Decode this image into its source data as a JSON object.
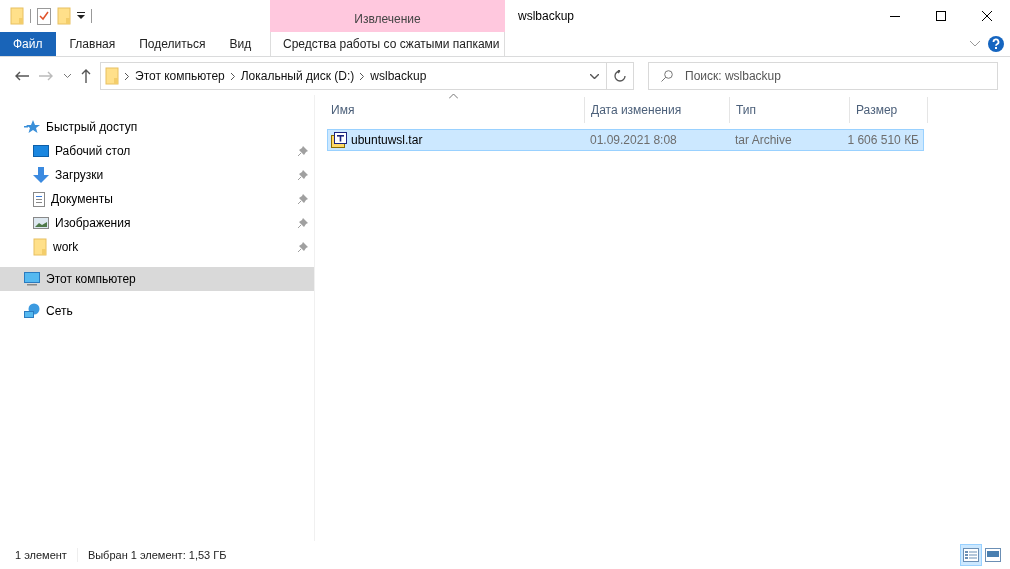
{
  "window": {
    "title": "wslbackup"
  },
  "contextual_group": {
    "label": "Извлечение"
  },
  "ribbon_tabs": [
    {
      "label": "Файл",
      "kind": "file"
    },
    {
      "label": "Главная",
      "kind": "normal"
    },
    {
      "label": "Поделиться",
      "kind": "normal"
    },
    {
      "label": "Вид",
      "kind": "normal"
    },
    {
      "label": "Средства работы со сжатыми папками",
      "kind": "contextual"
    }
  ],
  "address": {
    "path": [
      "Этот компьютер",
      "Локальный диск (D:)",
      "wslbackup"
    ]
  },
  "search": {
    "placeholder": "Поиск: wslbackup"
  },
  "sidebar": {
    "items": [
      {
        "label": "Быстрый доступ",
        "kind": "star",
        "selected": false,
        "children": [
          {
            "label": "Рабочий стол",
            "kind": "desktop",
            "pinned": true,
            "selected": false
          },
          {
            "label": "Загрузки",
            "kind": "download",
            "pinned": true,
            "selected": false
          },
          {
            "label": "Документы",
            "kind": "document",
            "pinned": true,
            "selected": false
          },
          {
            "label": "Изображения",
            "kind": "pictures",
            "pinned": true,
            "selected": false
          },
          {
            "label": "work",
            "kind": "folder",
            "pinned": true,
            "selected": false
          }
        ]
      },
      {
        "label": "Этот компьютер",
        "kind": "computer",
        "selected": true
      },
      {
        "label": "Сеть",
        "kind": "network",
        "selected": false
      }
    ]
  },
  "table": {
    "columns": [
      {
        "label": "Имя",
        "sorted": true
      },
      {
        "label": "Дата изменения",
        "sorted": false
      },
      {
        "label": "Тип",
        "sorted": false
      },
      {
        "label": "Размер",
        "sorted": false
      }
    ],
    "rows": [
      {
        "name": "ubuntuwsl.tar",
        "date": "01.09.2021 8:08",
        "type": "tar Archive",
        "size": "1 606 510 КБ",
        "selected": true
      }
    ]
  },
  "status_bar": {
    "count": "1 элемент",
    "selection": "Выбран 1 элемент: 1,53 ГБ"
  },
  "view_buttons": [
    {
      "kind": "details",
      "selected": true
    },
    {
      "kind": "tiles",
      "selected": false
    }
  ]
}
